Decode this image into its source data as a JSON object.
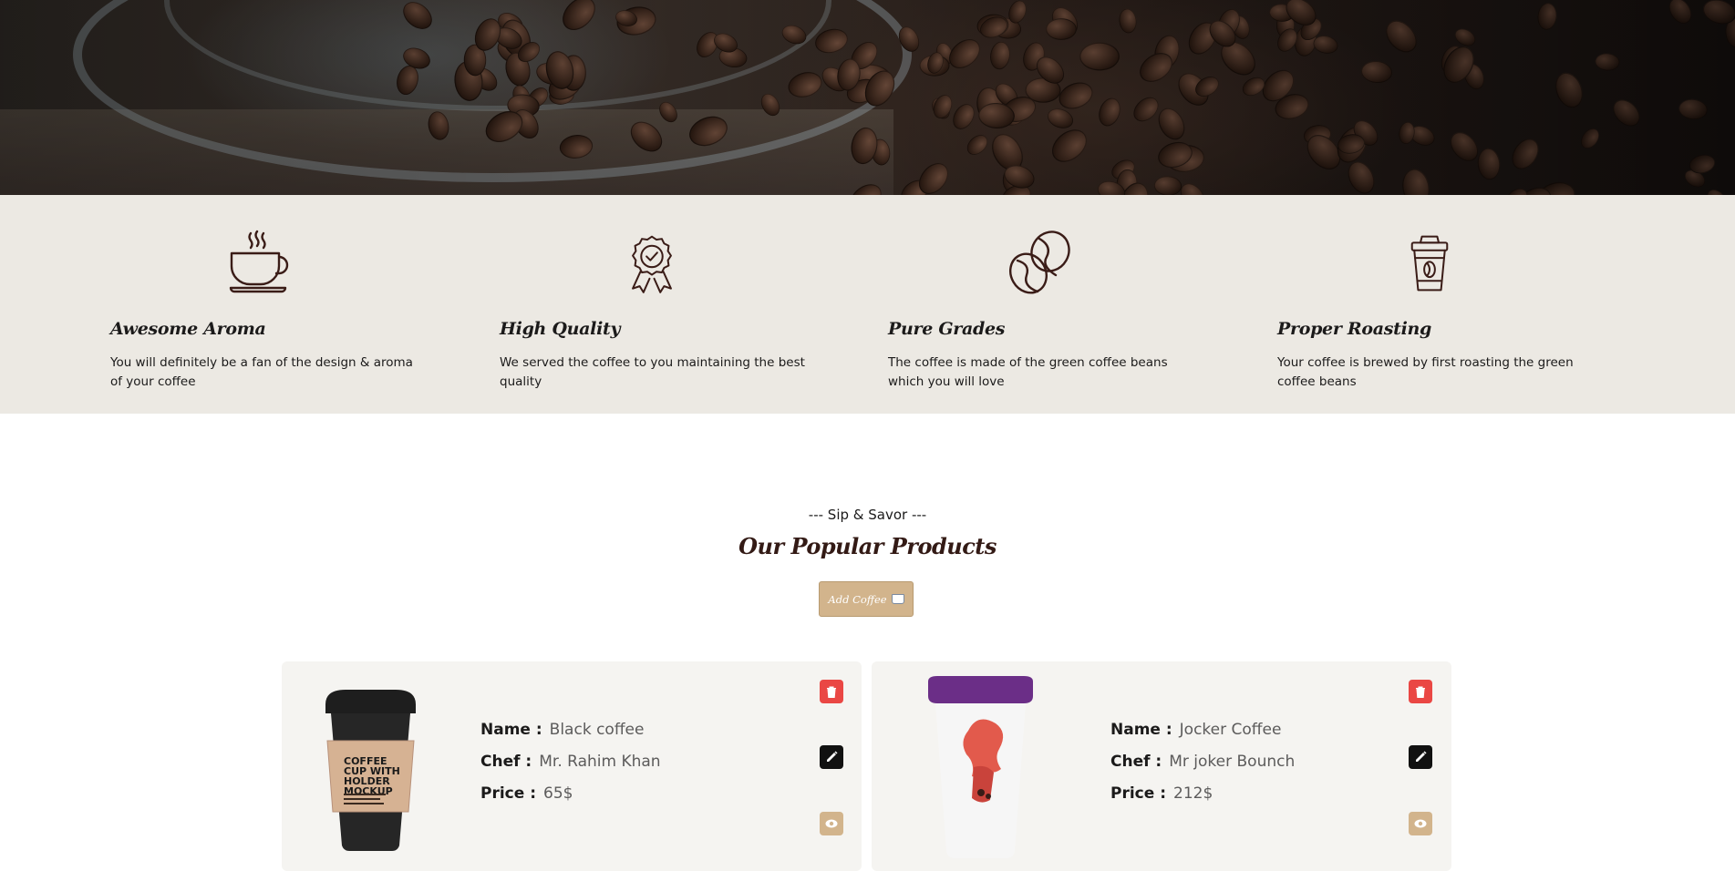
{
  "features": [
    {
      "icon": "coffee-cup-icon",
      "title": "Awesome Aroma",
      "text": "You will definitely be a fan of the design & aroma of your coffee"
    },
    {
      "icon": "quality-badge-icon",
      "title": "High Quality",
      "text": "We served the coffee to you maintaining the best quality"
    },
    {
      "icon": "coffee-bean-icon",
      "title": "Pure Grades",
      "text": "The coffee is made of the green coffee beans which you will love"
    },
    {
      "icon": "takeaway-cup-icon",
      "title": "Proper Roasting",
      "text": "Your coffee is brewed by first roasting the green coffee beans"
    }
  ],
  "popular": {
    "subtitle": "--- Sip & Savor ---",
    "title": "Our Popular Products",
    "add_button": "Add Coffee"
  },
  "labels": {
    "name": "Name :",
    "chef": "Chef :",
    "price": "Price :"
  },
  "products": [
    {
      "name": "Black coffee",
      "chef": "Mr. Rahim Khan",
      "price": "65$",
      "mockup_text": "COFFEE CUP WITH HOLDER MOCKUP"
    },
    {
      "name": "Jocker Coffee",
      "chef": "Mr joker Bounch",
      "price": "212$"
    }
  ],
  "colors": {
    "accent": "#D2B48C",
    "delete": "#EA4744",
    "edit": "#111111",
    "feature_bg": "#ECE9E3",
    "card_bg": "#F5F4F1"
  }
}
